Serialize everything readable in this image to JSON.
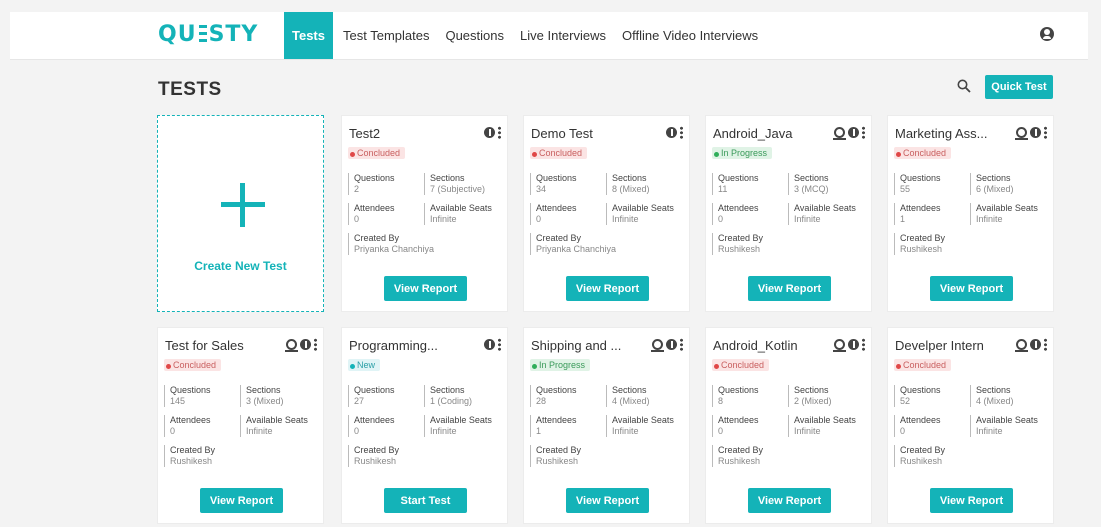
{
  "header": {
    "logo_left": "QU",
    "logo_right": "STY",
    "nav": [
      {
        "label": "Tests"
      },
      {
        "label": "Test Templates"
      },
      {
        "label": "Questions"
      },
      {
        "label": "Live Interviews"
      },
      {
        "label": "Offline Video Interviews"
      }
    ]
  },
  "page": {
    "title": "TESTS",
    "quick_test_label": "Quick Test",
    "create_label": "Create New Test"
  },
  "field_labels": {
    "questions": "Questions",
    "sections": "Sections",
    "attendees": "Attendees",
    "seats": "Available Seats",
    "created_by": "Created By"
  },
  "cards": [
    {
      "title": "Test2",
      "status": "Concluded",
      "questions": "2",
      "sections": "7 (Subjective)",
      "attendees": "0",
      "seats": "Infinite",
      "created_by": "Priyanka Chanchiya",
      "button": "View Report"
    },
    {
      "title": "Demo Test",
      "status": "Concluded",
      "questions": "34",
      "sections": "8 (Mixed)",
      "attendees": "0",
      "seats": "Infinite",
      "created_by": "Priyanka Chanchiya",
      "button": "View Report"
    },
    {
      "title": "Android_Java",
      "status": "In Progress",
      "questions": "11",
      "sections": "3 (MCQ)",
      "attendees": "0",
      "seats": "Infinite",
      "created_by": "Rushikesh",
      "button": "View Report"
    },
    {
      "title": "Marketing Ass...",
      "status": "Concluded",
      "questions": "55",
      "sections": "6 (Mixed)",
      "attendees": "1",
      "seats": "Infinite",
      "created_by": "Rushikesh",
      "button": "View Report"
    },
    {
      "title": "Test for Sales",
      "status": "Concluded",
      "questions": "145",
      "sections": "3 (Mixed)",
      "attendees": "0",
      "seats": "Infinite",
      "created_by": "Rushikesh",
      "button": "View Report"
    },
    {
      "title": "Programming...",
      "status": "New",
      "questions": "27",
      "sections": "1 (Coding)",
      "attendees": "0",
      "seats": "Infinite",
      "created_by": "Rushikesh",
      "button": "Start Test"
    },
    {
      "title": "Shipping and ...",
      "status": "In Progress",
      "questions": "28",
      "sections": "4 (Mixed)",
      "attendees": "1",
      "seats": "Infinite",
      "created_by": "Rushikesh",
      "button": "View Report"
    },
    {
      "title": "Android_Kotlin",
      "status": "Concluded",
      "questions": "8",
      "sections": "2 (Mixed)",
      "attendees": "0",
      "seats": "Infinite",
      "created_by": "Rushikesh",
      "button": "View Report"
    },
    {
      "title": "Develper Intern",
      "status": "Concluded",
      "questions": "52",
      "sections": "4 (Mixed)",
      "attendees": "0",
      "seats": "Infinite",
      "created_by": "Rushikesh",
      "button": "View Report"
    }
  ]
}
